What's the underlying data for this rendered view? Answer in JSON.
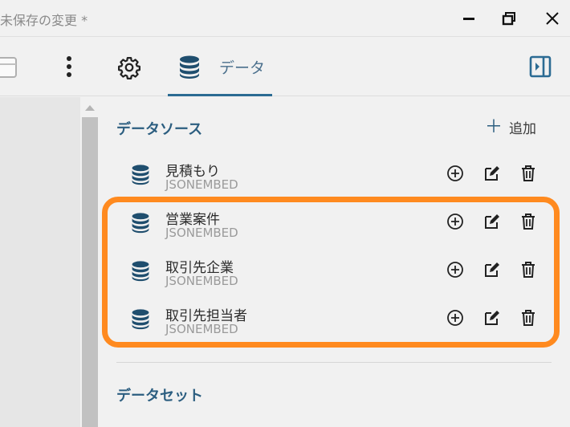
{
  "window": {
    "title": "未保存の変更 *"
  },
  "toolbar": {
    "data_tab_label": "データ"
  },
  "data_sources": {
    "title": "データソース",
    "add_label": "追加",
    "items": [
      {
        "name": "見積もり",
        "type": "JSONEMBED"
      },
      {
        "name": "営業案件",
        "type": "JSONEMBED"
      },
      {
        "name": "取引先企業",
        "type": "JSONEMBED"
      },
      {
        "name": "取引先担当者",
        "type": "JSONEMBED"
      }
    ]
  },
  "data_sets": {
    "title": "データセット"
  },
  "colors": {
    "accent": "#2b6b93",
    "highlight": "#ff8a1f",
    "icon": "#1f4e6e"
  }
}
